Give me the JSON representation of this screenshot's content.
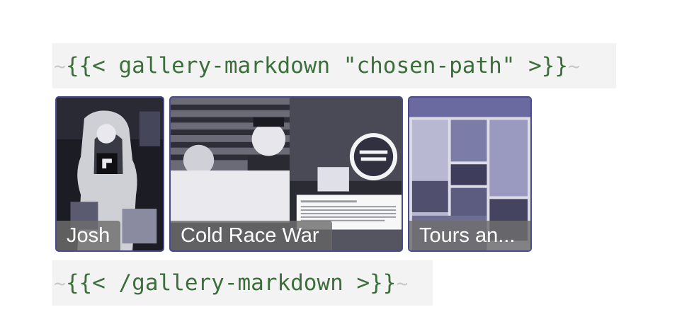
{
  "shortcode_open": {
    "tilde_left": "~",
    "text": "{{< gallery-markdown \"chosen-path\" >}}",
    "tilde_right": "~"
  },
  "gallery": {
    "items": [
      {
        "label": "Josh"
      },
      {
        "label": "Cold Race War"
      },
      {
        "label": "Tours an..."
      }
    ]
  },
  "shortcode_close": {
    "tilde_left": "~",
    "text": "{{< /gallery-markdown >}}",
    "tilde_right": "~"
  },
  "colors": {
    "code_text": "#3b6e3b",
    "code_background": "#f3f3f3",
    "thumb_border": "#4a4a8c",
    "tilde": "#c8c8c8"
  }
}
